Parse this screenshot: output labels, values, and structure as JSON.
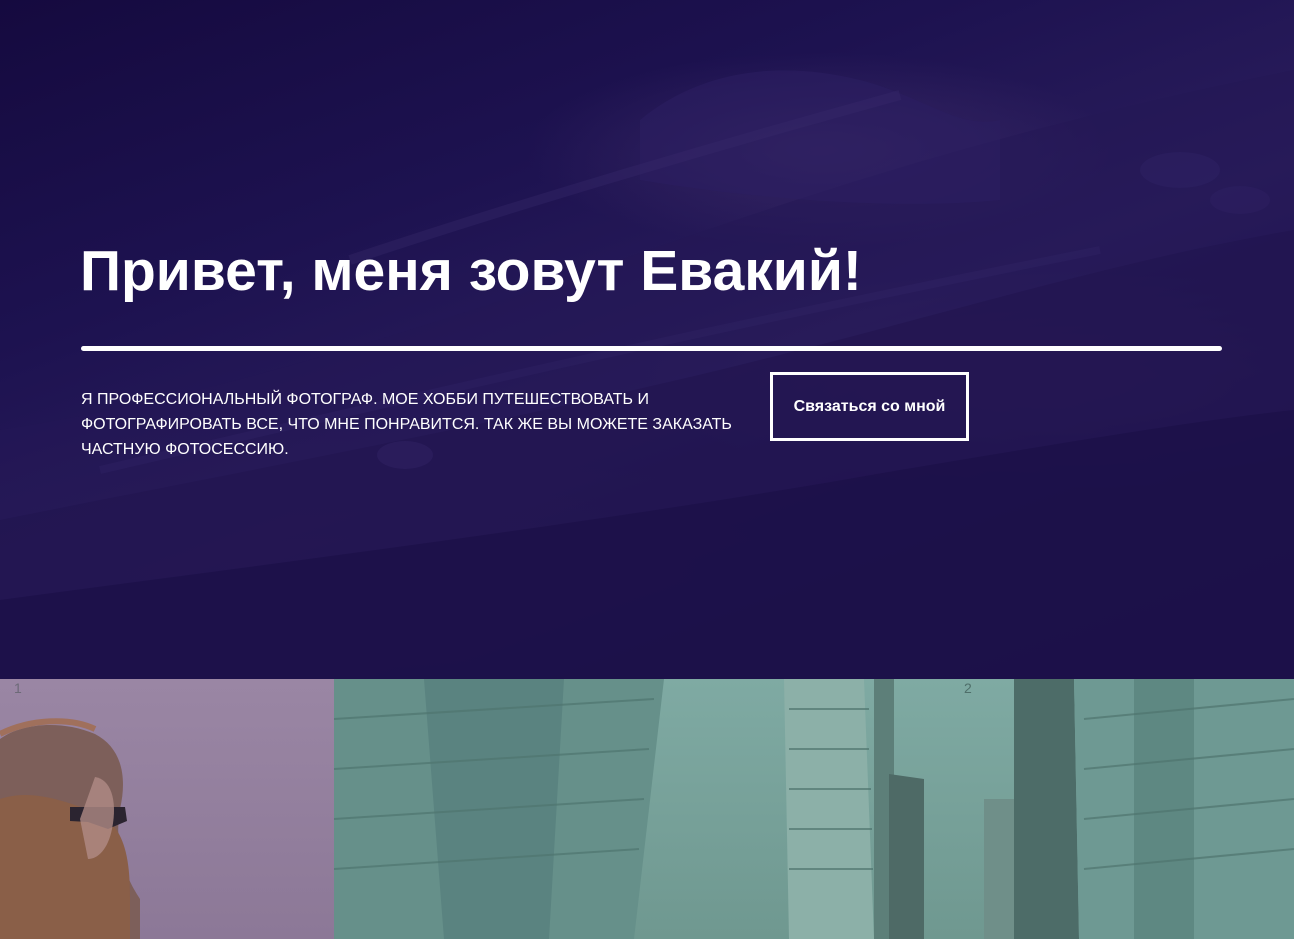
{
  "hero": {
    "title": "Привет, меня зовут Евакий!",
    "description": "Я профессиональный фотограф. Мое хобби путешествовать и фотографировать все, что мне понравится. Так же вы можете заказать частную фотосессию.",
    "contact_button_label": "Связаться со мной",
    "background_tint": "#1a0e45"
  },
  "gallery": {
    "slides": [
      {
        "number": "1",
        "image": "portrait-photo",
        "tint": "#9a86a4"
      },
      {
        "number": "2",
        "image": "city-buildings-photo",
        "tint": "#7faaa3"
      }
    ]
  },
  "colors": {
    "text": "#ffffff",
    "accent": "#ffffff"
  }
}
